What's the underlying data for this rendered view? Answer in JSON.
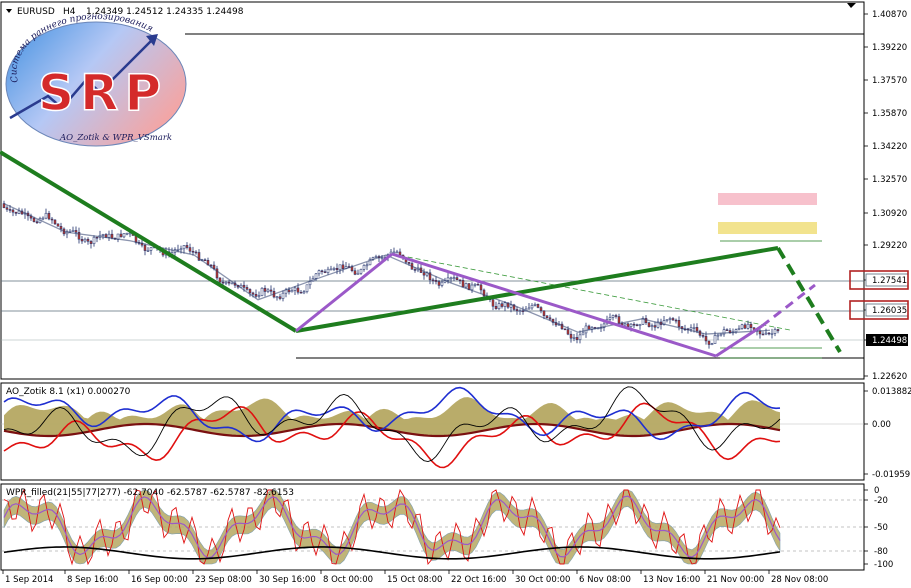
{
  "header": {
    "symbol": "EURUSD",
    "timeframe": "H4",
    "ohlc": "1.24349 1.24512 1.24335 1.24498"
  },
  "logo": {
    "big": "SRP",
    "arc_text": "Система раннего прогнозирования",
    "bottom_text": "AO_Zotik & WPR_VSmark"
  },
  "colors": {
    "trend": "#1e7d1e",
    "wave": "#9b59c8",
    "zone_pink": "#f7c1cc",
    "zone_yellow": "#f2e38e",
    "box_outline": "#b22222",
    "ao_fill": "#b5a862",
    "ao_blue": "#1f2fd1",
    "ao_red": "#e01010",
    "ao_darkred": "#7a1010"
  },
  "price_axis": {
    "ticks": [
      "1.40870",
      "1.39220",
      "1.37570",
      "1.35870",
      "1.34220",
      "1.32570",
      "1.30920",
      "1.29220",
      "1.27541",
      "1.26035",
      "1.24498",
      "1.22620"
    ],
    "boxed": [
      "1.27541",
      "1.26035"
    ],
    "current": "1.24498"
  },
  "time_axis": {
    "labels": [
      "1 Sep 2014",
      "8 Sep 16:00",
      "16 Sep 00:00",
      "23 Sep 08:00",
      "30 Sep 16:00",
      "8 Oct 00:00",
      "15 Oct 08:00",
      "22 Oct 16:00",
      "30 Oct 00:00",
      "6 Nov 08:00",
      "13 Nov 16:00",
      "21 Nov 00:00",
      "28 Nov 08:00"
    ]
  },
  "ao_panel": {
    "label": "AO_Zotik 8.1 (x1) 0.000270",
    "ticks": [
      "0.013882",
      "0.00",
      "-0.01959"
    ]
  },
  "wpr_panel": {
    "label": "WPR_filled(21|55|77|277) -62.7040 -62.5787 -62.5787 -82.6153",
    "ticks": [
      "0",
      "-20",
      "-50",
      "-80",
      "-100"
    ]
  },
  "chart_data": {
    "type": "line",
    "series": [
      {
        "name": "",
        "x": [
          "1 Sep 2014",
          "8 Sep 16:00",
          "16 Sep 00:00",
          "23 Sep 08:00",
          "30 Sep 16:00",
          "8 Oct 00:00",
          "15 Oct 08:00",
          "22 Oct 16:00",
          "30 Oct 00:00",
          "6 Nov 08:00",
          "13 Nov 16:00",
          "21 Nov 00:00",
          "28 Nov 08:00"
        ],
        "values": [
          1.3125,
          1.2975,
          1.293,
          1.2855,
          1.262,
          1.274,
          1.2855,
          1.271,
          1.259,
          1.245,
          1.252,
          1.244,
          1.246
        ]
      }
    ],
    "ylim": [
      1.222,
      1.412
    ]
  }
}
